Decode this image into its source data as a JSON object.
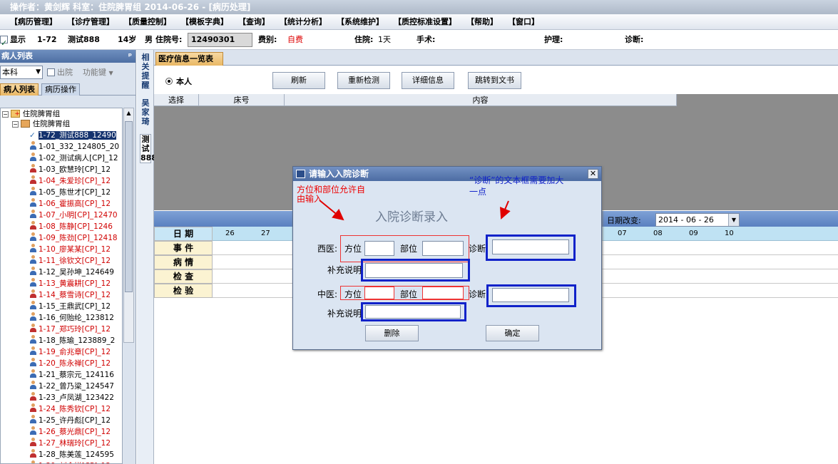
{
  "titlebar": {
    "text": "操作者：黄剑辉   科室：住院脾胃组   2014-06-26 - [病历处理]"
  },
  "menu": [
    "【病历管理】",
    "【诊疗管理】",
    "【质量控制】",
    "【模板字典】",
    "【查询】",
    "【统计分析】",
    "【系统维护】",
    "【质控标准设置】",
    "【帮助】",
    "【窗口】"
  ],
  "patient": {
    "show_label": "显示",
    "bed": "1-72",
    "name": "测试888",
    "age": "14岁",
    "sex": "男",
    "inpatient_no_label": "住院号:",
    "inpatient_no": "12490301",
    "fee_label": "费别:",
    "fee_value": "自费",
    "stay_label": "住院:",
    "stay_value": "1天",
    "surgery_label": "手术:",
    "nursing_label": "护理:",
    "diagnosis_label": "诊断:"
  },
  "left_panel": {
    "title": "病人列表",
    "pin": "ᵖ",
    "dept": "本科",
    "discharged_label": "出院",
    "function_key": "功能键",
    "tabs": [
      "病人列表",
      "病历操作"
    ],
    "tree_root": "住院脾胃组",
    "tree_group": "住院脾胃组",
    "patients": [
      {
        "text": "1-72_测试888_12490",
        "female": false,
        "red": false,
        "selected": true
      },
      {
        "text": "1-01_332_124805_20",
        "female": false,
        "red": false
      },
      {
        "text": "1-02_测试病人[CP]_12",
        "female": false,
        "red": false
      },
      {
        "text": "1-03_欧慧玲[CP]_12",
        "female": true,
        "red": false
      },
      {
        "text": "1-04_朱爱珍[CP]_12",
        "female": true,
        "red": true
      },
      {
        "text": "1-05_陈世才[CP]_12",
        "female": false,
        "red": false
      },
      {
        "text": "1-06_霍振高[CP]_12",
        "female": false,
        "red": true
      },
      {
        "text": "1-07_小明[CP]_12470",
        "female": false,
        "red": true
      },
      {
        "text": "1-08_陈静[CP]_1246",
        "female": true,
        "red": true
      },
      {
        "text": "1-09_陈劲[CP]_12418",
        "female": false,
        "red": true
      },
      {
        "text": "1-10_廖某某[CP]_12",
        "female": false,
        "red": true
      },
      {
        "text": "1-11_徐钦文[CP]_12",
        "female": false,
        "red": true
      },
      {
        "text": "1-12_吴孙坤_124649",
        "female": false,
        "red": false
      },
      {
        "text": "1-13_黄震耕[CP]_12",
        "female": false,
        "red": true
      },
      {
        "text": "1-14_蔡雪诗[CP]_12",
        "female": true,
        "red": true
      },
      {
        "text": "1-15_王鼎武[CP]_12",
        "female": false,
        "red": false
      },
      {
        "text": "1-16_何贻纶_123812",
        "female": false,
        "red": false
      },
      {
        "text": "1-17_郑巧玲[CP]_12",
        "female": true,
        "red": true
      },
      {
        "text": "1-18_陈瑜_123889_2",
        "female": false,
        "red": false
      },
      {
        "text": "1-19_俞兆章[CP]_12",
        "female": false,
        "red": true
      },
      {
        "text": "1-20_陈永禅[CP]_12",
        "female": false,
        "red": true
      },
      {
        "text": "1-21_蔡宗元_124116",
        "female": false,
        "red": false
      },
      {
        "text": "1-22_曾乃梁_124547",
        "female": false,
        "red": false
      },
      {
        "text": "1-23_卢凤湖_123422",
        "female": true,
        "red": false
      },
      {
        "text": "1-24_陈秀钦[CP]_12",
        "female": true,
        "red": true
      },
      {
        "text": "1-25_许丹彪[CP]_12",
        "female": false,
        "red": false
      },
      {
        "text": "1-26_蔡光鼎[CP]_12",
        "female": false,
        "red": true
      },
      {
        "text": "1-27_林瑞玲[CP]_12",
        "female": true,
        "red": true
      },
      {
        "text": "1-28_陈美莲_124595",
        "female": true,
        "red": false
      },
      {
        "text": "1-29_刘金娣[CP]_12",
        "female": true,
        "red": true
      }
    ]
  },
  "side_strip": {
    "v1": "相关提醒",
    "v2": "吴家琦",
    "v3": "测试888"
  },
  "main": {
    "tab": "医疗信息一览表",
    "radio_label": "本人",
    "buttons": {
      "refresh": "刷新",
      "recheck": "重新检测",
      "detail": "详细信息",
      "jump": "跳转到文书"
    },
    "grid_cols": [
      "选择",
      "床号",
      "内容"
    ],
    "date_change_label": "日期改变:",
    "date_value": "2014 - 06 - 26",
    "row_labels": [
      "日 期",
      "事 件",
      "病 情",
      "检 查",
      "检 验"
    ],
    "days": [
      "26",
      "27",
      "07",
      "08",
      "09",
      "10"
    ]
  },
  "dialog": {
    "title": "请输入入院诊断",
    "close": "✕",
    "heading": "入院诊断录入",
    "western_label": "西医:",
    "chinese_label": "中医:",
    "orient_label": "方位",
    "part_label": "部位",
    "diag_label": "诊断",
    "extra_label": "补充说明",
    "delete_btn": "删除",
    "ok_btn": "确定"
  },
  "annotations": {
    "red_note": "方位和部位允许自由输入",
    "blue_note": "“诊断”的文本框需要加大一点",
    "red_color": "#e00000",
    "blue_color": "#1022c9"
  }
}
